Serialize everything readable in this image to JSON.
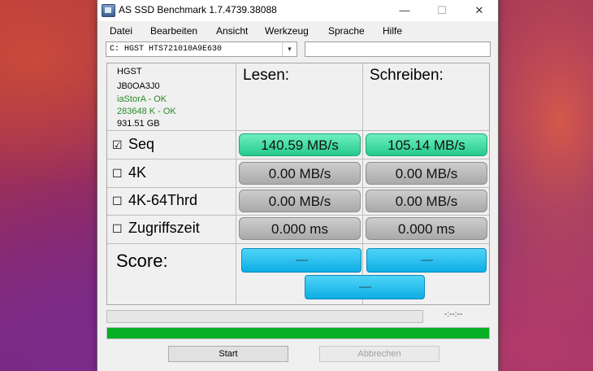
{
  "window": {
    "title": "AS SSD Benchmark 1.7.4739.38088",
    "controls": {
      "minimize": "—",
      "maximize": "☐",
      "close": "✕"
    }
  },
  "menu": [
    "Datei",
    "Bearbeiten",
    "Ansicht",
    "Werkzeug",
    "Sprache",
    "Hilfe"
  ],
  "drive": {
    "selected": "C: HGST HTS721010A9E630",
    "arrow": "▾"
  },
  "info": {
    "model": "HGST",
    "firmware": "JB0OA3J0",
    "driver": "iaStorA - OK",
    "alignment": "283648 K - OK",
    "capacity": "931.51 GB"
  },
  "headers": {
    "read": "Lesen:",
    "write": "Schreiben:"
  },
  "rows": [
    {
      "label": "Seq",
      "checked": true,
      "read": "140.59 MB/s",
      "write": "105.14 MB/s"
    },
    {
      "label": "4K",
      "checked": false,
      "read": "0.00 MB/s",
      "write": "0.00 MB/s"
    },
    {
      "label": "4K-64Thrd",
      "checked": false,
      "read": "0.00 MB/s",
      "write": "0.00 MB/s"
    },
    {
      "label": "Zugriffszeit",
      "checked": false,
      "read": "0.000 ms",
      "write": "0.000 ms"
    }
  ],
  "check_symbols": {
    "checked": "☑",
    "unchecked": "☐"
  },
  "score": {
    "label": "Score:",
    "read": "-----",
    "write": "-----",
    "total": "-----"
  },
  "progress": {
    "time": "-:--:--",
    "fraction": 1.0
  },
  "buttons": {
    "start": "Start",
    "abort": "Abbrechen"
  },
  "colors": {
    "result_green": "#25c98d",
    "result_gray": "#a9a9a9",
    "score_blue": "#0eaee4",
    "progress_green": "#06b025"
  }
}
